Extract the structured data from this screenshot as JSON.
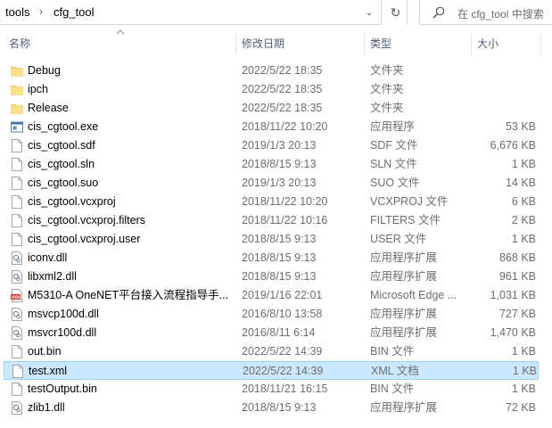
{
  "address": {
    "crumbs": [
      "tools",
      "cfg_tool"
    ],
    "search_placeholder": "在 cfg_tool 中搜索"
  },
  "columns": {
    "name": "名称",
    "date": "修改日期",
    "type": "类型",
    "size": "大小"
  },
  "files": [
    {
      "name": "Debug",
      "date": "2022/5/22 18:35",
      "type": "文件夹",
      "size": "",
      "icon": "folder-icon"
    },
    {
      "name": "ipch",
      "date": "2022/5/22 18:35",
      "type": "文件夹",
      "size": "",
      "icon": "folder-icon"
    },
    {
      "name": "Release",
      "date": "2022/5/22 18:35",
      "type": "文件夹",
      "size": "",
      "icon": "folder-icon"
    },
    {
      "name": "cis_cgtool.exe",
      "date": "2018/11/22 10:20",
      "type": "应用程序",
      "size": "53 KB",
      "icon": "exe-icon"
    },
    {
      "name": "cis_cgtool.sdf",
      "date": "2019/1/3 20:13",
      "type": "SDF 文件",
      "size": "6,676 KB",
      "icon": "file-icon"
    },
    {
      "name": "cis_cgtool.sln",
      "date": "2018/8/15 9:13",
      "type": "SLN 文件",
      "size": "1 KB",
      "icon": "file-icon"
    },
    {
      "name": "cis_cgtool.suo",
      "date": "2019/1/3 20:13",
      "type": "SUO 文件",
      "size": "14 KB",
      "icon": "file-icon"
    },
    {
      "name": "cis_cgtool.vcxproj",
      "date": "2018/11/22 10:20",
      "type": "VCXPROJ 文件",
      "size": "6 KB",
      "icon": "file-icon"
    },
    {
      "name": "cis_cgtool.vcxproj.filters",
      "date": "2018/11/22 10:16",
      "type": "FILTERS 文件",
      "size": "2 KB",
      "icon": "file-icon"
    },
    {
      "name": "cis_cgtool.vcxproj.user",
      "date": "2018/8/15 9:13",
      "type": "USER 文件",
      "size": "1 KB",
      "icon": "file-icon"
    },
    {
      "name": "iconv.dll",
      "date": "2018/8/15 9:13",
      "type": "应用程序扩展",
      "size": "868 KB",
      "icon": "dll-icon"
    },
    {
      "name": "libxml2.dll",
      "date": "2018/8/15 9:13",
      "type": "应用程序扩展",
      "size": "961 KB",
      "icon": "dll-icon"
    },
    {
      "name": "M5310-A OneNET平台接入流程指导手...",
      "date": "2019/1/16 22:01",
      "type": "Microsoft Edge ...",
      "size": "1,031 KB",
      "icon": "pdf-icon"
    },
    {
      "name": "msvcp100d.dll",
      "date": "2016/8/10 13:58",
      "type": "应用程序扩展",
      "size": "727 KB",
      "icon": "dll-icon"
    },
    {
      "name": "msvcr100d.dll",
      "date": "2016/8/11 6:14",
      "type": "应用程序扩展",
      "size": "1,470 KB",
      "icon": "dll-icon"
    },
    {
      "name": "out.bin",
      "date": "2022/5/22 14:39",
      "type": "BIN 文件",
      "size": "1 KB",
      "icon": "file-icon"
    },
    {
      "name": "test.xml",
      "date": "2022/5/22 14:39",
      "type": "XML 文档",
      "size": "1 KB",
      "icon": "file-icon",
      "selected": true
    },
    {
      "name": "testOutput.bin",
      "date": "2018/11/21 16:15",
      "type": "BIN 文件",
      "size": "1 KB",
      "icon": "file-icon"
    },
    {
      "name": "zlib1.dll",
      "date": "2018/8/15 9:13",
      "type": "应用程序扩展",
      "size": "72 KB",
      "icon": "dll-icon"
    }
  ],
  "colors": {
    "selection_bg": "#cce8ff",
    "selection_border": "#99d1ff",
    "folder": "#f8d775",
    "header_text": "#4c607a"
  }
}
